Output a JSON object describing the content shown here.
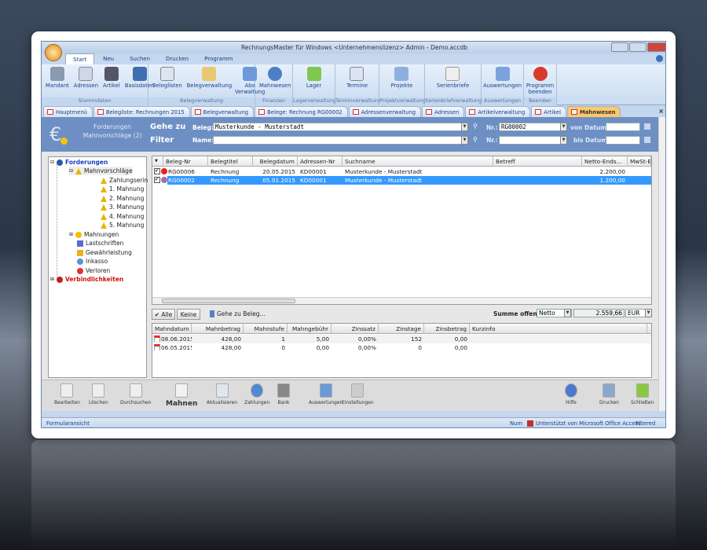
{
  "window": {
    "title": "RechnungsMaster für Windows <Unternehmenslizenz> Admin - Demo.accdb"
  },
  "ribbon_tabs": [
    "Start",
    "Neu",
    "Suchen",
    "Drucken",
    "Programm"
  ],
  "ribbon_groups": [
    {
      "label": "Stammdaten",
      "buttons": [
        "Mandant",
        "Adressen",
        "Artikel",
        "Basisdaten"
      ]
    },
    {
      "label": "Belegverwaltung",
      "buttons": [
        "Beleglisten",
        "Belegverwaltung",
        "Abo Verwaltung"
      ]
    },
    {
      "label": "Finanzen",
      "buttons": [
        "Mahnwesen"
      ]
    },
    {
      "label": "Lagerverwaltung",
      "buttons": [
        "Lager"
      ]
    },
    {
      "label": "Terminverwaltung",
      "buttons": [
        "Termine"
      ]
    },
    {
      "label": "Projektverwaltung",
      "buttons": [
        "Projekte"
      ]
    },
    {
      "label": "Serienbriefverwaltung",
      "buttons": [
        "Serienbriefe"
      ]
    },
    {
      "label": "Auswertungen",
      "buttons": [
        "Auswertungen"
      ]
    },
    {
      "label": "Beenden",
      "buttons": [
        "Programm beenden"
      ]
    }
  ],
  "doc_tabs": [
    "Hauptmenü",
    "Belegliste: Rechnungen 2015",
    "Belegverwaltung",
    "Belege: Rechnung RG00002",
    "Adressenverwaltung",
    "Adressen",
    "Artikelverwaltung",
    "Artikel",
    "Mahnwesen"
  ],
  "header": {
    "title1": "Forderungen",
    "title2": "Mahnvorschläge (2)",
    "goto": "Gehe zu",
    "filter": "Filter",
    "beleg_label": "Beleg:",
    "beleg_value": "Musterkunde - Musterstadt",
    "name_label": "Name:",
    "name_value": "",
    "nr_label": "Nr.:",
    "nr1_value": "RG00002",
    "nr2_value": "",
    "von_label": "von Datum:",
    "bis_label": "bis Datum:"
  },
  "tree": [
    "Forderungen",
    "Mahnvorschläge",
    "Zahlungserin",
    "1. Mahnung",
    "2. Mahnung",
    "3. Mahnung",
    "4. Mahnung",
    "5. Mahnung",
    "Mahnungen",
    "Lastschriften",
    "Gewährleistung",
    "Inkasso",
    "Verloren",
    "Verbindlichkeiten"
  ],
  "grid": {
    "columns": [
      "Beleg-Nr",
      "Belegtitel",
      "Belegdatum",
      "Adressen-Nr",
      "Suchname",
      "Betreff",
      "Netto-Ends...",
      "MwSt-E"
    ],
    "rows": [
      {
        "nr": "RG00006",
        "titel": "Rechnung",
        "datum": "20.05.2015",
        "adr": "KD00001",
        "such": "Musterkunde - Musterstadt",
        "betreff": "",
        "netto": "2.200,00",
        "status_color": "#e8231a",
        "selected": false
      },
      {
        "nr": "RG00002",
        "titel": "Rechnung",
        "datum": "05.01.2015",
        "adr": "KD00001",
        "such": "Musterkunde - Musterstadt",
        "betreff": "",
        "netto": "1.200,00",
        "status_color": "#a070a0",
        "selected": true
      }
    ]
  },
  "actions": {
    "alle": "✔ Alle",
    "keine": "Keine",
    "goto_beleg": "Gehe zu Beleg...",
    "summe_label": "Summe offen:",
    "summe_mode": "Netto",
    "summe_value": "2.559,66",
    "currency": "EUR"
  },
  "sub": {
    "columns": [
      "Mahndatum",
      "Mahnbetrag",
      "Mahnstufe",
      "Mahngebühr",
      "Zinssatz",
      "Zinstage",
      "Zinsbetrag",
      "Kurzinfo"
    ],
    "rows": [
      [
        "08.06.2015",
        "428,00",
        "1",
        "5,00",
        "0,00%",
        "152",
        "0,00",
        ""
      ],
      [
        "06.05.2015",
        "428,00",
        "0",
        "0,00",
        "0,00%",
        "0",
        "0,00",
        ""
      ]
    ]
  },
  "toolbar": [
    "Bearbeiten",
    "Löschen",
    "Durchsuchen",
    "Mahnen",
    "Aktualisieren",
    "Zahlungen",
    "Bank",
    "Auswertungen",
    "Einstellungen",
    "Hilfe",
    "Drucken",
    "Schließen"
  ],
  "status": {
    "left": "Formularansicht",
    "num": "Num",
    "access": "Unterstützt von Microsoft Office Access",
    "filtered": "Filtered"
  }
}
